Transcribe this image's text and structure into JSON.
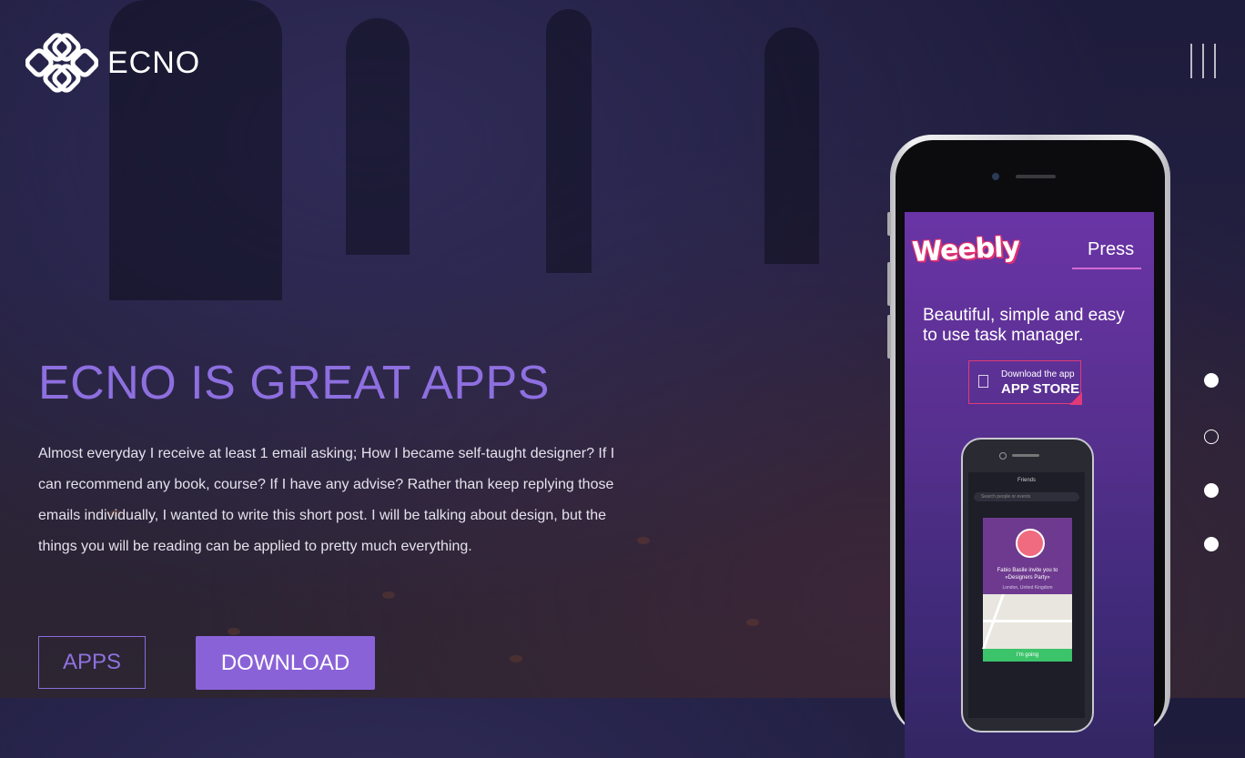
{
  "brand": {
    "name": "ECNO"
  },
  "hero": {
    "headline": "ECNO IS GREAT APPS",
    "body": "Almost everyday I receive at least 1 email asking; How I became self-taught designer? If I can recommend any book, course? If I have any advise? Rather than keep replying those emails individually, I wanted to write this short post. I will be talking about design, but the things you will be reading can be applied to pretty much everything."
  },
  "buttons": {
    "apps_label": "APPS",
    "download_label": "DOWNLOAD"
  },
  "menu": {
    "icon": "hamburger-icon"
  },
  "slider": {
    "count": 4,
    "active_index": 1
  },
  "phone_screen": {
    "brand": "Weebly",
    "nav_item": "Press",
    "tagline": "Beautiful, simple and easy to use task manager.",
    "store_small": "Download the app",
    "store_big": "APP STORE",
    "mini_app": {
      "title": "Friends",
      "search_placeholder": "Search people or events",
      "invite_text": "Fabio Basile invite you to «Designers Party»",
      "location": "London, United Kingdom",
      "action": "I'm going"
    }
  },
  "colors": {
    "accent": "#8a62d8",
    "headline": "#8e6fe0"
  }
}
